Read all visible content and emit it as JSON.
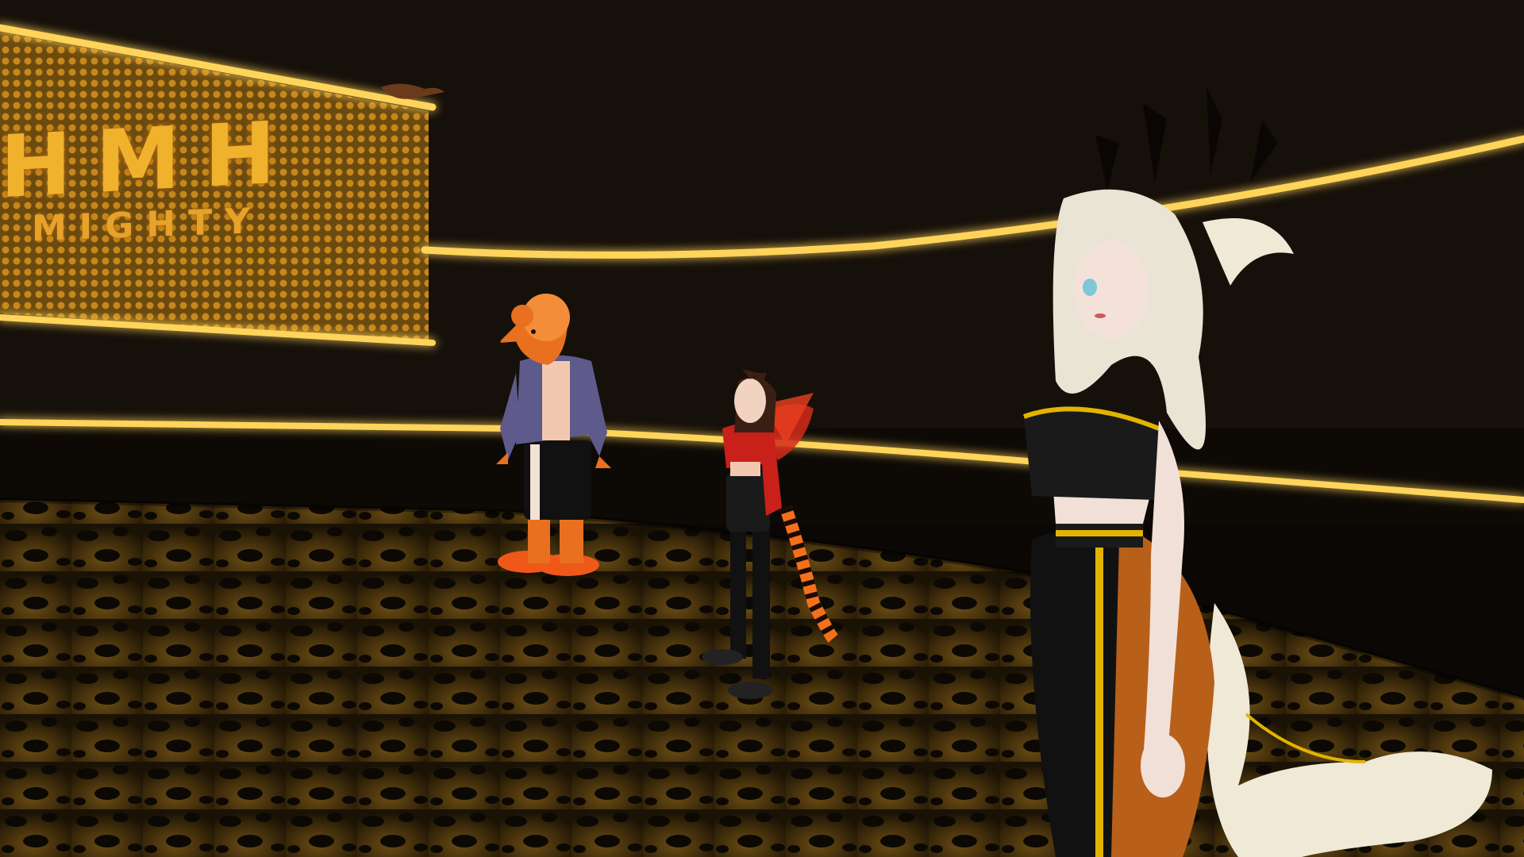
{
  "sign": {
    "logo": "H M H",
    "word": "MIGHTY"
  },
  "colors": {
    "neon": "#ffcf4a",
    "floor": "#3a2a0a",
    "spots": "#0c0904",
    "wall": "#16100a"
  },
  "avatars": [
    {
      "name": "mouse-avatar"
    },
    {
      "name": "fox-girl-avatar"
    },
    {
      "name": "blonde-avatar"
    }
  ]
}
